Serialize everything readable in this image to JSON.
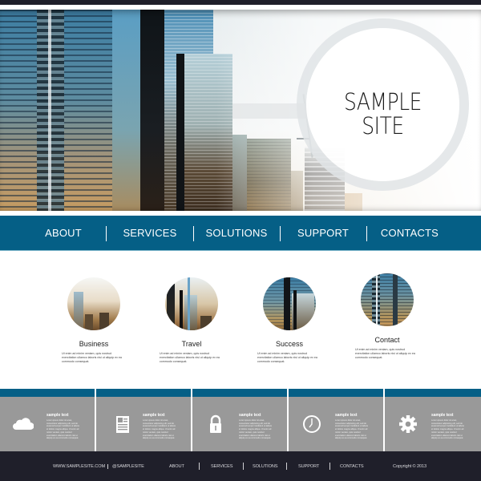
{
  "hero": {
    "title_line1": "SAMPLE",
    "title_line2": "SITE"
  },
  "nav": {
    "items": [
      {
        "label": "ABOUT"
      },
      {
        "label": "SERVICES"
      },
      {
        "label": "SOLUTIONS"
      },
      {
        "label": "SUPPORT"
      },
      {
        "label": "CONTACTS"
      }
    ]
  },
  "features": [
    {
      "title": "Business",
      "text": "Ut enim ad minim veniam, quis nostrud exercitation ullamco laboris nisi ut aliquip ex ea commodo consequat."
    },
    {
      "title": "Travel",
      "text": "Ut enim ad minim veniam, quis nostrud exercitation ullamco laboris nisi ut aliquip ex ea commodo consequat."
    },
    {
      "title": "Success",
      "text": "Ut enim ad minim veniam, quis nostrud exercitation ullamco laboris nisi ut aliquip ex ea commodo consequat."
    },
    {
      "title": "Contact",
      "text": "Ut enim ad minim veniam, quis nostrud exercitation ullamco laboris nisi ut aliquip ex ea commodo consequat."
    }
  ],
  "info_bar": {
    "cells": [
      {
        "icon": "cloud-icon",
        "title": "sample text",
        "text": "Lorem ipsum dolor sit amet, consectetur adipiscing elit, sed do eiusmod tempor incididunt ut labore et dolore magna aliqua. Ut enim ad minim veniam, quis nostrud exercitation ullamco laboris nisi ut aliquip ex ea commodo consequat."
      },
      {
        "icon": "document-icon",
        "title": "sample text",
        "text": "Lorem ipsum dolor sit amet, consectetur adipiscing elit, sed do eiusmod tempor incididunt ut labore et dolore magna aliqua. Ut enim ad minim veniam, quis nostrud exercitation ullamco laboris nisi ut aliquip ex ea commodo consequat."
      },
      {
        "icon": "lock-icon",
        "title": "sample text",
        "text": "Lorem ipsum dolor sit amet, consectetur adipiscing elit, sed do eiusmod tempor incididunt ut labore et dolore magna aliqua. Ut enim ad minim veniam, quis nostrud exercitation ullamco laboris nisi ut aliquip ex ea commodo consequat."
      },
      {
        "icon": "clock-icon",
        "title": "sample text",
        "text": "Lorem ipsum dolor sit amet, consectetur adipiscing elit, sed do eiusmod tempor incididunt ut labore et dolore magna aliqua. Ut enim ad minim veniam, quis nostrud exercitation ullamco laboris nisi ut aliquip ex ea commodo consequat."
      },
      {
        "icon": "gear-icon",
        "title": "sample text",
        "text": "Lorem ipsum dolor sit amet, consectetur adipiscing elit, sed do eiusmod tempor incididunt ut labore et dolore magna aliqua. Ut enim ad minim veniam, quis nostrud exercitation ullamco laboris nisi ut aliquip ex ea commodo consequat."
      }
    ]
  },
  "footer": {
    "website": "WWW.SAMPLESITE.COM",
    "handle": "@SAMPLESITE",
    "links": [
      {
        "label": "ABOUT"
      },
      {
        "label": "SERVICES"
      },
      {
        "label": "SOLUTIONS"
      },
      {
        "label": "SUPPORT"
      },
      {
        "label": "CONTACTS"
      }
    ],
    "copyright": "Copyright © 2013"
  },
  "colors": {
    "brand_blue": "#055f86",
    "dark": "#1f1f2a",
    "info_gray": "#999999"
  }
}
